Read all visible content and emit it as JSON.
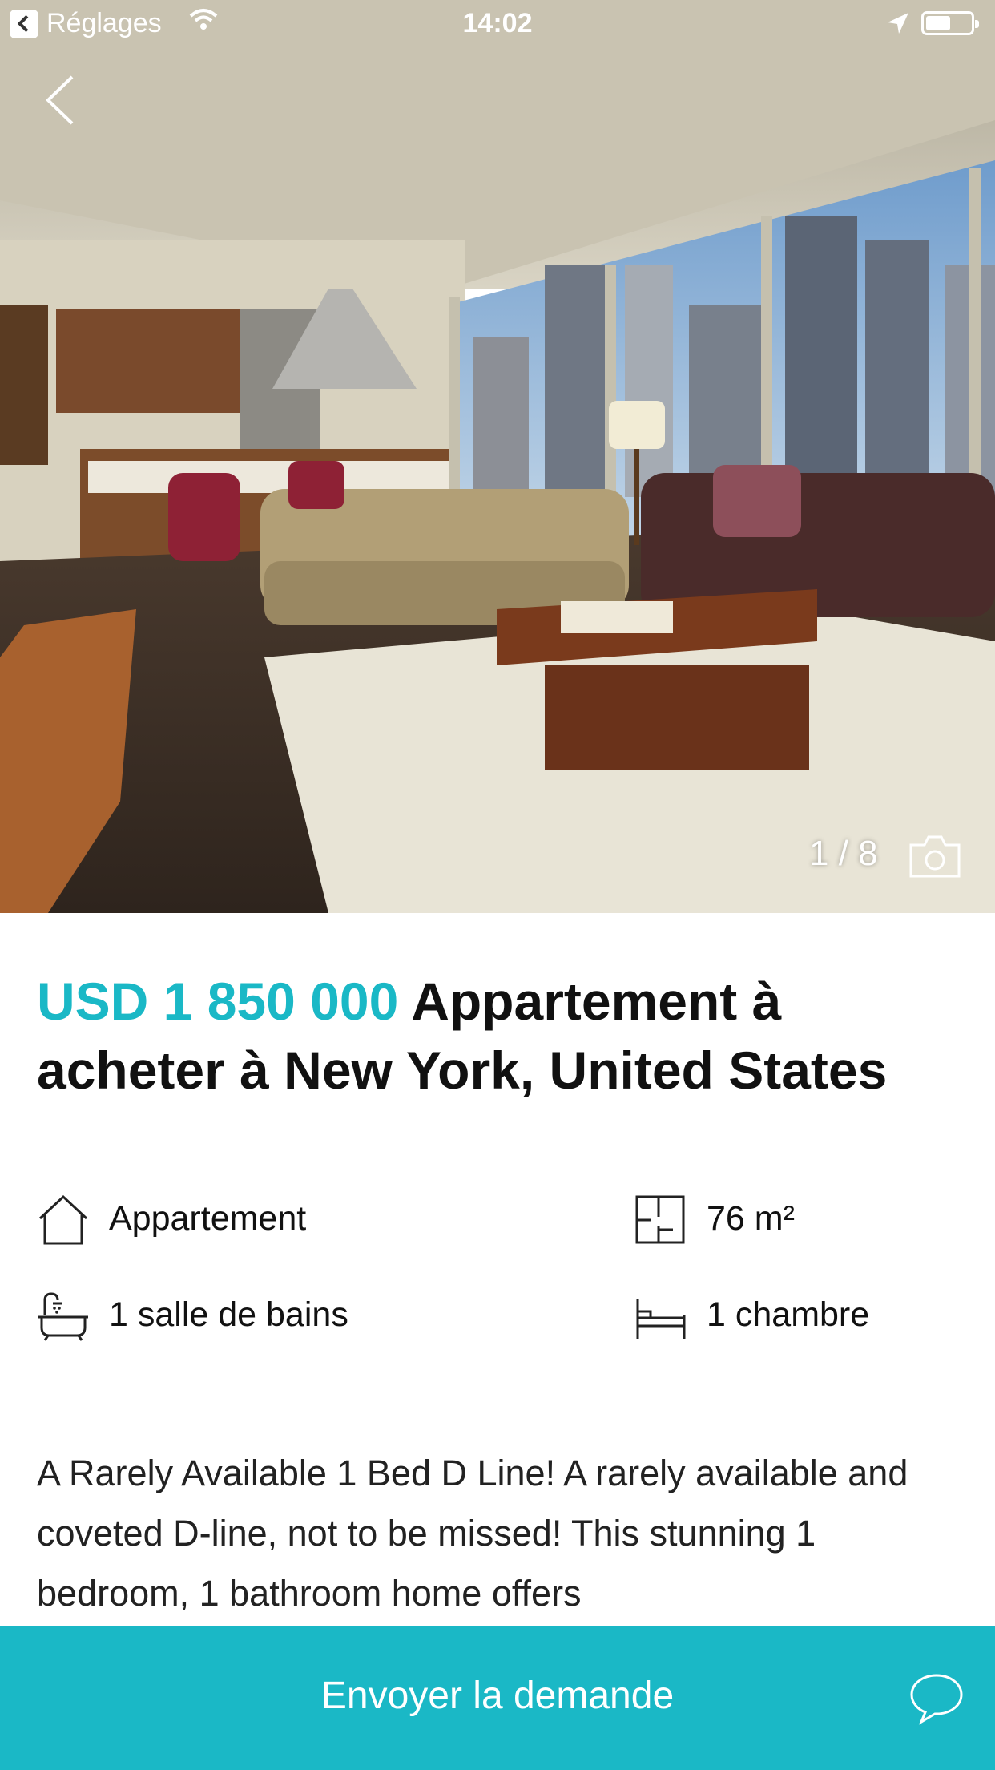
{
  "status_bar": {
    "back_app": "Réglages",
    "time": "14:02",
    "battery_level": 0.55
  },
  "gallery": {
    "counter": "1 / 8"
  },
  "listing": {
    "price": "USD 1 850 000",
    "title": "Appartement à acheter à New York, United States",
    "features": [
      {
        "icon": "house-icon",
        "label": "Appartement"
      },
      {
        "icon": "floorplan-icon",
        "label": "76 m²"
      },
      {
        "icon": "bathtub-icon",
        "label": "1 salle de bains"
      },
      {
        "icon": "bed-icon",
        "label": "1 chambre"
      }
    ],
    "description": "A Rarely Available 1 Bed D Line! A rarely available and coveted D-line, not to be missed! This stunning 1 bedroom, 1 bathroom home offers"
  },
  "cta": {
    "label": "Envoyer la demande"
  },
  "colors": {
    "accent": "#1ab8c6"
  }
}
